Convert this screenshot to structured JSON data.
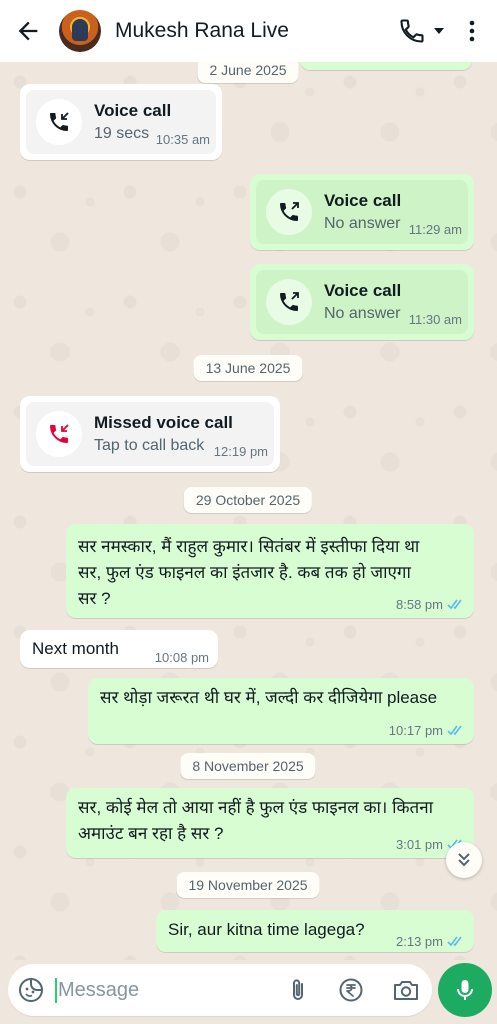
{
  "header": {
    "contact_name": "Mukesh Rana Live",
    "avatar": "avatar"
  },
  "chat": {
    "dates": [
      "2 June 2025",
      "13 June 2025",
      "29 October 2025",
      "8 November 2025",
      "19 November 2025"
    ],
    "calls": [
      {
        "title": "Voice call",
        "sub": "19 secs",
        "time": "10:35 am",
        "direction": "incoming"
      },
      {
        "title": "Voice call",
        "sub": "No answer",
        "time": "11:29 am",
        "direction": "outgoing"
      },
      {
        "title": "Voice call",
        "sub": "No answer",
        "time": "11:30 am",
        "direction": "outgoing"
      },
      {
        "title": "Missed voice call",
        "sub": "Tap to call back",
        "time": "12:19 pm",
        "direction": "missed"
      }
    ],
    "messages": [
      {
        "text_lines": [
          "सर नमस्कार, मैं राहुल कुमार। सितंबर में इस्तीफा दिया था",
          "सर, फुल एंड फाइनल का इंतजार है. कब तक हो जाएगा",
          "सर ?"
        ],
        "time": "8:58 pm",
        "direction": "out"
      },
      {
        "text_lines": [
          "Next month"
        ],
        "time": "10:08 pm",
        "direction": "in"
      },
      {
        "text_lines": [
          "सर थोड़ा जरूरत थी घर में, जल्दी कर दीजियेगा please"
        ],
        "time": "10:17 pm",
        "direction": "out"
      },
      {
        "text_lines": [
          "सर, कोई मेल तो आया नहीं है फुल एंड फाइनल का। कितना",
          "अमाउंट बन रहा है सर ?"
        ],
        "time": "3:01 pm",
        "direction": "out"
      },
      {
        "text_lines": [
          "Sir, aur kitna time lagega?"
        ],
        "time": "2:13 pm",
        "direction": "out"
      }
    ]
  },
  "composer": {
    "placeholder": "Message"
  },
  "colors": {
    "accent": "#1daa61",
    "outgoing_bubble": "#d9fdd3",
    "read_tick": "#53bdeb",
    "missed_call": "#ea0038"
  }
}
